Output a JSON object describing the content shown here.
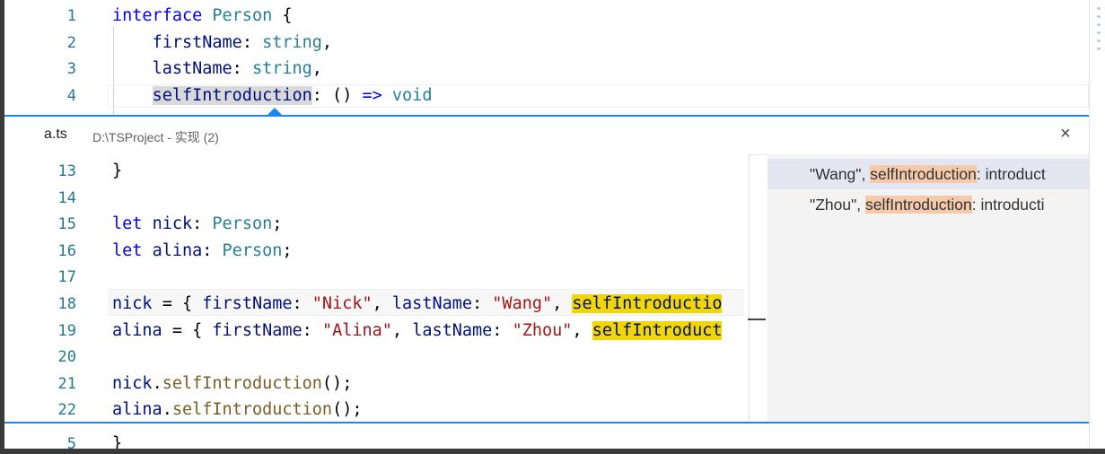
{
  "top_editor": {
    "lines": [
      {
        "num": "1",
        "tokens": [
          {
            "t": "interface",
            "c": "kw"
          },
          {
            "t": " ",
            "c": "pl"
          },
          {
            "t": "Person",
            "c": "ty"
          },
          {
            "t": " {",
            "c": "pl"
          }
        ]
      },
      {
        "num": "2",
        "tokens": [
          {
            "t": "    ",
            "c": "pl"
          },
          {
            "t": "firstName",
            "c": "var"
          },
          {
            "t": ": ",
            "c": "pl"
          },
          {
            "t": "string",
            "c": "ty"
          },
          {
            "t": ",",
            "c": "pl"
          }
        ]
      },
      {
        "num": "3",
        "tokens": [
          {
            "t": "    ",
            "c": "pl"
          },
          {
            "t": "lastName",
            "c": "var"
          },
          {
            "t": ": ",
            "c": "pl"
          },
          {
            "t": "string",
            "c": "ty"
          },
          {
            "t": ",",
            "c": "pl"
          }
        ]
      },
      {
        "num": "4",
        "tokens": [
          {
            "t": "    ",
            "c": "pl"
          },
          {
            "t": "selfIntroduction",
            "c": "var hl-gray"
          },
          {
            "t": ": () ",
            "c": "pl"
          },
          {
            "t": "=>",
            "c": "kw"
          },
          {
            "t": " ",
            "c": "pl"
          },
          {
            "t": "void",
            "c": "ty"
          }
        ]
      }
    ]
  },
  "peek": {
    "file_name": "a.ts",
    "path_info": "D:\\TSProject - 实现 (2)",
    "close_icon": "×",
    "lines": [
      {
        "num": "13",
        "tokens": [
          {
            "t": "}",
            "c": "pl"
          }
        ]
      },
      {
        "num": "14",
        "tokens": []
      },
      {
        "num": "15",
        "tokens": [
          {
            "t": "let",
            "c": "kw"
          },
          {
            "t": " ",
            "c": "pl"
          },
          {
            "t": "nick",
            "c": "var"
          },
          {
            "t": ": ",
            "c": "pl"
          },
          {
            "t": "Person",
            "c": "ty"
          },
          {
            "t": ";",
            "c": "pl"
          }
        ]
      },
      {
        "num": "16",
        "tokens": [
          {
            "t": "let",
            "c": "kw"
          },
          {
            "t": " ",
            "c": "pl"
          },
          {
            "t": "alina",
            "c": "var"
          },
          {
            "t": ": ",
            "c": "pl"
          },
          {
            "t": "Person",
            "c": "ty"
          },
          {
            "t": ";",
            "c": "pl"
          }
        ]
      },
      {
        "num": "17",
        "tokens": []
      },
      {
        "num": "18",
        "tokens": [
          {
            "t": "nick",
            "c": "var"
          },
          {
            "t": " = { ",
            "c": "pl"
          },
          {
            "t": "firstName",
            "c": "var"
          },
          {
            "t": ": ",
            "c": "pl"
          },
          {
            "t": "\"Nick\"",
            "c": "str"
          },
          {
            "t": ", ",
            "c": "pl"
          },
          {
            "t": "lastName",
            "c": "var"
          },
          {
            "t": ": ",
            "c": "pl"
          },
          {
            "t": "\"Wang\"",
            "c": "str"
          },
          {
            "t": ", ",
            "c": "pl"
          },
          {
            "t": "selfIntroductio",
            "c": "var hl-yellow"
          }
        ]
      },
      {
        "num": "19",
        "tokens": [
          {
            "t": "alina",
            "c": "var"
          },
          {
            "t": " = { ",
            "c": "pl"
          },
          {
            "t": "firstName",
            "c": "var"
          },
          {
            "t": ": ",
            "c": "pl"
          },
          {
            "t": "\"Alina\"",
            "c": "str"
          },
          {
            "t": ", ",
            "c": "pl"
          },
          {
            "t": "lastName",
            "c": "var"
          },
          {
            "t": ": ",
            "c": "pl"
          },
          {
            "t": "\"Zhou\"",
            "c": "str"
          },
          {
            "t": ", ",
            "c": "pl"
          },
          {
            "t": "selfIntroduct",
            "c": "var hl-yellow"
          }
        ]
      },
      {
        "num": "20",
        "tokens": []
      },
      {
        "num": "21",
        "tokens": [
          {
            "t": "nick",
            "c": "var"
          },
          {
            "t": ".",
            "c": "pl"
          },
          {
            "t": "selfIntroduction",
            "c": "fn"
          },
          {
            "t": "();",
            "c": "pl"
          }
        ]
      },
      {
        "num": "22",
        "tokens": [
          {
            "t": "alina",
            "c": "var"
          },
          {
            "t": ".",
            "c": "pl"
          },
          {
            "t": "selfIntroduction",
            "c": "fn"
          },
          {
            "t": "();",
            "c": "pl"
          }
        ]
      }
    ],
    "references": [
      {
        "before": "\"Wang\", ",
        "match": "selfIntroduction",
        "after": ": introduct",
        "selected": true
      },
      {
        "before": "\"Zhou\", ",
        "match": "selfIntroduction",
        "after": ": introducti",
        "selected": false
      }
    ]
  },
  "bottom_editor": {
    "lines": [
      {
        "num": "5",
        "tokens": [
          {
            "t": "}",
            "c": "pl"
          }
        ]
      }
    ]
  },
  "colors": {
    "accent": "#1a85ff",
    "keyword": "#0000ff",
    "type": "#267f99",
    "variable": "#001080",
    "string": "#a31515",
    "function": "#795e26",
    "highlight_yellow": "#f2d600",
    "reference_highlight": "#f5c9a9"
  }
}
